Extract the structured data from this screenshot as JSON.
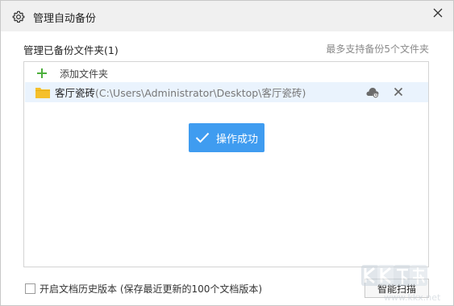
{
  "window": {
    "title": "管理自动备份"
  },
  "header": {
    "section_title": "管理已备份文件夹(1)",
    "hint": "最多支持备份5个文件夹"
  },
  "panel": {
    "add_label": "添加文件夹",
    "folders": [
      {
        "name": "客厅瓷砖",
        "path": "(C:\\Users\\Administrator\\Desktop\\客厅瓷砖)"
      }
    ]
  },
  "toast": {
    "text": "操作成功"
  },
  "footer": {
    "checkbox_label": "开启文档历史版本 (保存最近更新的100个文档版本)",
    "checkbox_checked": false,
    "scan_button": "智能扫描"
  },
  "watermark": {
    "logo_text": "KK下载",
    "url": "www.kkx.net"
  },
  "colors": {
    "accent": "#3f9cf0",
    "plus_green": "#4caf3c",
    "folder_yellow": "#f5c02a",
    "row_highlight": "#eaf3fd"
  },
  "icons": {
    "title": "gear-icon",
    "close": "close-icon",
    "add": "plus-icon",
    "folder": "folder-icon",
    "cloud": "cloud-sync-icon",
    "remove": "remove-icon",
    "toast": "checkmark-icon"
  }
}
